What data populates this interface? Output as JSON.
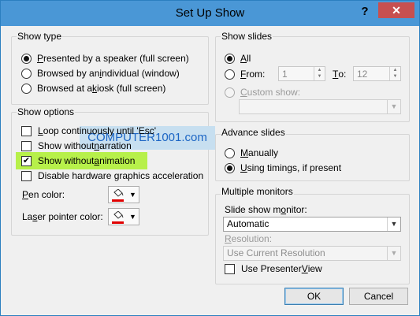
{
  "window": {
    "title": "Set Up Show",
    "help": "?",
    "close": "✕"
  },
  "show_type": {
    "title": "Show type",
    "options": [
      {
        "label_pre": "",
        "underline": "P",
        "label_post": "resented by a speaker (full screen)",
        "selected": true
      },
      {
        "label_pre": "Browsed by an ",
        "underline": "i",
        "label_post": "ndividual (window)",
        "selected": false
      },
      {
        "label_pre": "Browsed at a ",
        "underline": "k",
        "label_post": "iosk (full screen)",
        "selected": false
      }
    ]
  },
  "show_options": {
    "title": "Show options",
    "checkboxes": [
      {
        "label_pre": "",
        "underline": "L",
        "label_post": "oop continuously until 'Esc'",
        "checked": false
      },
      {
        "label_pre": "Show without ",
        "underline": "n",
        "label_post": "arration",
        "checked": false
      },
      {
        "label_pre": "Show without ",
        "underline": "a",
        "label_post": "nimation",
        "checked": true
      },
      {
        "label_pre": "Disable hardware graphics acceleration",
        "underline": "",
        "label_post": "",
        "checked": false
      }
    ],
    "pen_color": {
      "label_pre": "",
      "underline": "P",
      "label_post": "en color:"
    },
    "laser_color": {
      "label_pre": "La",
      "underline": "s",
      "label_post": "er pointer color:"
    },
    "color_value": "#e00000"
  },
  "watermark": "COMPUTER1001.com",
  "show_slides": {
    "title": "Show slides",
    "all": {
      "label_pre": "",
      "underline": "A",
      "label_post": "ll",
      "selected": true
    },
    "from": {
      "label_pre": "",
      "underline": "F",
      "label_post": "rom:",
      "selected": false
    },
    "from_value": "1",
    "to": {
      "label_pre": "",
      "underline": "T",
      "label_post": "o:"
    },
    "to_value": "12",
    "custom": {
      "label_pre": "",
      "underline": "C",
      "label_post": "ustom show:",
      "selected": false
    },
    "custom_value": ""
  },
  "advance_slides": {
    "title": "Advance slides",
    "manually": {
      "label_pre": "",
      "underline": "M",
      "label_post": "anually",
      "selected": false
    },
    "timings": {
      "label_pre": "",
      "underline": "U",
      "label_post": "sing timings, if present",
      "selected": true
    }
  },
  "monitors": {
    "title": "Multiple monitors",
    "monitor_label": {
      "label_pre": "Slide show m",
      "underline": "o",
      "label_post": "nitor:"
    },
    "monitor_value": "Automatic",
    "resolution_label": {
      "label_pre": "",
      "underline": "R",
      "label_post": "esolution:"
    },
    "resolution_value": "Use Current Resolution",
    "presenter": {
      "label_pre": "Use Presenter ",
      "underline": "V",
      "label_post": "iew",
      "checked": false
    }
  },
  "buttons": {
    "ok": "OK",
    "cancel": "Cancel"
  },
  "icons": {
    "radio": "radio-button",
    "checkbox": "checkbox",
    "dropdown": "chevron-down-icon",
    "bucket": "paint-bucket-icon"
  }
}
